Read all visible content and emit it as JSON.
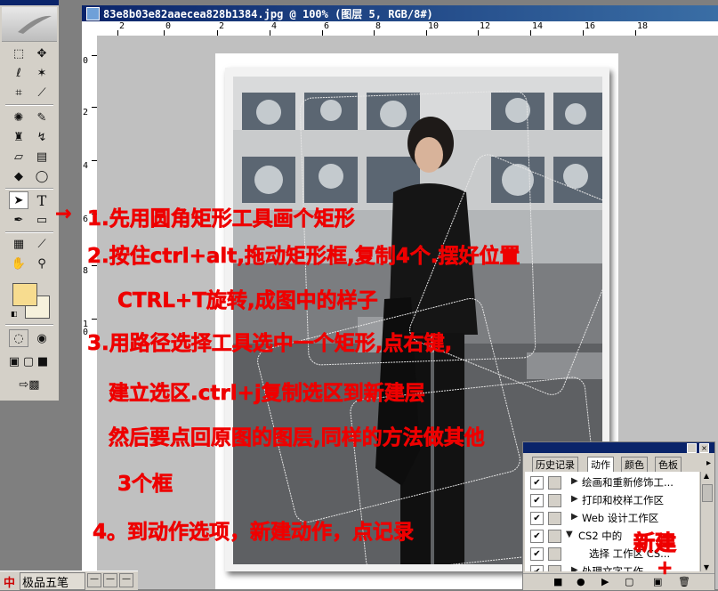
{
  "document": {
    "title": "83e8b03e82aaecea828b1384.jpg @ 100% (图层 5, RGB/8#)"
  },
  "rulers": {
    "horizontal": [
      "2",
      "0",
      "2",
      "4",
      "6",
      "8",
      "10",
      "12",
      "14",
      "16",
      "18"
    ],
    "vertical": [
      "0",
      "2",
      "4",
      "6",
      "8",
      "1\n0"
    ]
  },
  "annotations": {
    "line1": "1.先用圆角矩形工具画个矩形",
    "line2": "2.按住ctrl+alt,拖动矩形框,复制4个.摆好位置",
    "line3": "CTRL+T旋转,成图中的样子",
    "line4": "3.用路径选择工具选中一个矩形,点右键,",
    "line5": "建立选区.ctrl+j复制选区到新建层",
    "line6": "然后要点回原图的图层,同样的方法做其他",
    "line7": "3个框",
    "line8": "4。到动作选项，新建动作，点记录",
    "arrow": "→",
    "new_label": "新建",
    "plus": "+"
  },
  "panel": {
    "tabs": [
      "历史记录",
      "动作",
      "颜色",
      "色板"
    ],
    "active_tab": "动作",
    "rows": [
      {
        "label": "绘画和重新修饰工..."
      },
      {
        "label": "打印和校样工作区"
      },
      {
        "label": "Web 设计工作区"
      },
      {
        "label": "CS2 中的"
      },
      {
        "label": "选择 工作区 CS..."
      },
      {
        "label": "处理文字工作"
      }
    ]
  },
  "ime": {
    "label": "极品五笔",
    "icon": "中"
  },
  "colors": {
    "foreground": "#f7dc8f",
    "background": "#f6f1dc",
    "annotation": "#ee0000"
  }
}
